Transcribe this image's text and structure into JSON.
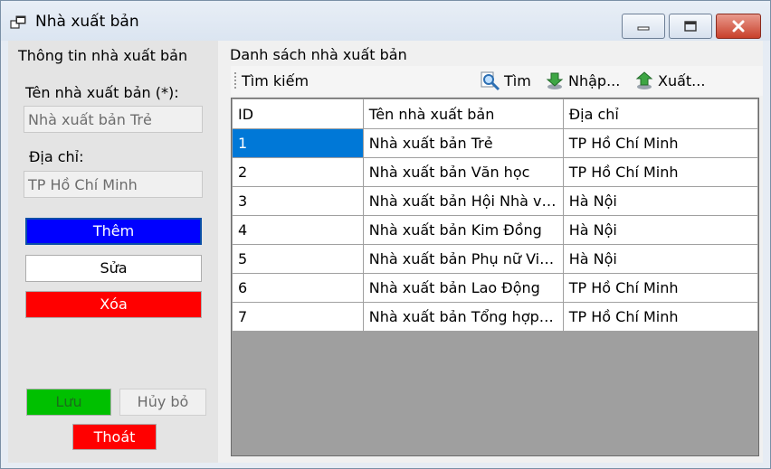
{
  "window": {
    "title": "Nhà xuất bản"
  },
  "left_panel": {
    "title": "Thông tin nhà xuất bản",
    "name_label": "Tên nhà xuất bản (*):",
    "name_value": "Nhà xuất bản Trẻ",
    "address_label": "Địa chỉ:",
    "address_value": "TP Hồ Chí Minh",
    "buttons": {
      "add": "Thêm",
      "edit": "Sửa",
      "delete": "Xóa",
      "save": "Lưu",
      "cancel": "Hủy bỏ",
      "exit": "Thoát"
    }
  },
  "right_panel": {
    "title": "Danh sách nhà xuất bản",
    "toolbar": {
      "search_label": "Tìm kiếm",
      "search_value": "",
      "find": "Tìm",
      "import": "Nhập...",
      "export": "Xuất..."
    },
    "table": {
      "columns": [
        "ID",
        "Tên nhà xuất bản",
        "Địa chỉ"
      ],
      "rows": [
        [
          "1",
          "Nhà xuất bản Trẻ",
          "TP Hồ Chí Minh"
        ],
        [
          "2",
          "Nhà xuất bản Văn học",
          "TP Hồ Chí Minh"
        ],
        [
          "3",
          "Nhà xuất bản Hội Nhà văn",
          "Hà Nội"
        ],
        [
          "4",
          "Nhà xuất bản Kim Đồng",
          "Hà Nội"
        ],
        [
          "5",
          "Nhà xuất bản Phụ nữ Việ...",
          "Hà Nội"
        ],
        [
          "6",
          "Nhà xuất bản Lao Động",
          "TP Hồ Chí Minh"
        ],
        [
          "7",
          "Nhà xuất bản Tổng hợp ...",
          "TP Hồ Chí Minh"
        ]
      ]
    }
  },
  "colors": {
    "add_button": "#0000ff",
    "delete_button": "#ff0000",
    "save_button": "#00c000",
    "exit_button": "#ff0000",
    "selected_cell": "#0078d7"
  },
  "icons": {
    "app": "window-icon",
    "find": "magnifier-icon",
    "import": "download-arrow-icon",
    "export": "upload-arrow-icon"
  }
}
